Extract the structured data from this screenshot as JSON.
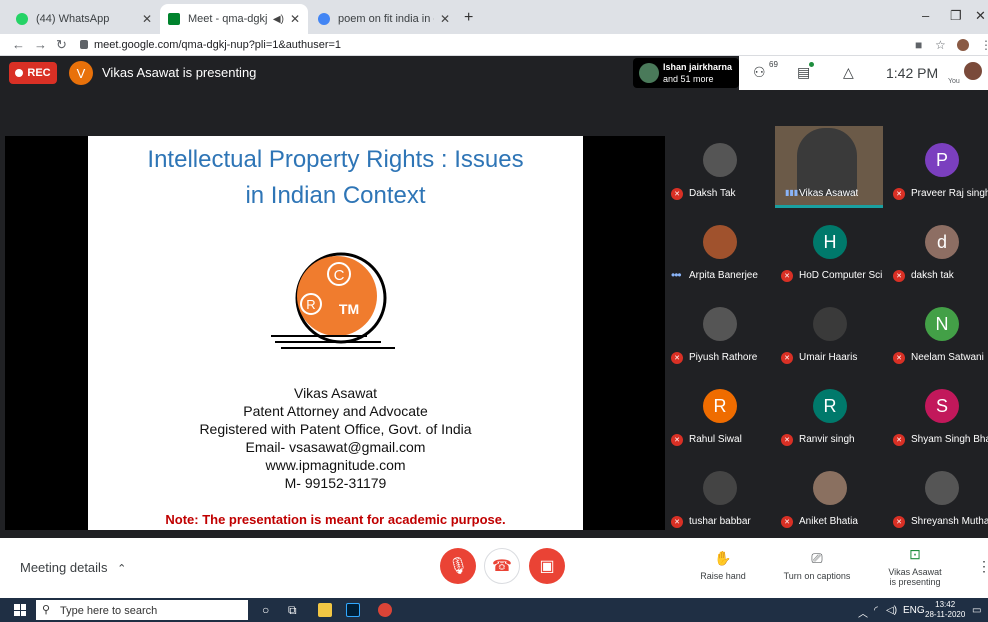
{
  "browser": {
    "tabs": [
      {
        "title": "(44) WhatsApp",
        "favicon_color": "#25d366"
      },
      {
        "title": "Meet - qma-dgkj-nup",
        "favicon_color": "#00832d"
      },
      {
        "title": "poem on fit india in english - Go",
        "favicon_color": "#4285f4"
      }
    ],
    "url": "meet.google.com/qma-dgkj-nup?pli=1&authuser=1"
  },
  "meet": {
    "rec_label": "REC",
    "presenter_initial": "V",
    "presenting_text": "Vikas Asawat is presenting",
    "join_notification": {
      "line1": "Ishan jairkharna",
      "line2": "and 51 more"
    },
    "participant_count_badge": "69",
    "clock": "1:42 PM",
    "self_label": "You"
  },
  "slide": {
    "title_line1": "Intellectual Property Rights : Issues",
    "title_line2": "in Indian Context",
    "logo_letters": {
      "c": "C",
      "r": "R",
      "tm": "TM"
    },
    "author": "Vikas Asawat",
    "role": "Patent Attorney and Advocate",
    "registration": "Registered with Patent Office, Govt. of India",
    "email": "Email- vsasawat@gmail.com",
    "website": "www.ipmagnitude.com",
    "mobile": "M- 99152-31179",
    "note": "Note: The presentation is meant for academic purpose."
  },
  "participants": [
    {
      "name": "Daksh Tak",
      "initial": "",
      "color": "#555555",
      "status": "muted"
    },
    {
      "name": "Vikas Asawat",
      "initial": "",
      "color": "#6b5a48",
      "status": "speaking"
    },
    {
      "name": "Praveer Raj singh",
      "initial": "P",
      "color": "#7b3fbf",
      "status": "muted"
    },
    {
      "name": "Arpita Banerjee",
      "initial": "",
      "color": "#a0522d",
      "status": "dots"
    },
    {
      "name": "HoD Computer Sci...",
      "initial": "H",
      "color": "#00796b",
      "status": "muted"
    },
    {
      "name": "daksh tak",
      "initial": "d",
      "color": "#8d6e63",
      "status": "muted"
    },
    {
      "name": "Piyush Rathore",
      "initial": "",
      "color": "#555555",
      "status": "muted"
    },
    {
      "name": "Umair Haaris",
      "initial": "",
      "color": "#3a3a3a",
      "status": "muted"
    },
    {
      "name": "Neelam Satwani",
      "initial": "N",
      "color": "#43a047",
      "status": "muted"
    },
    {
      "name": "Rahul Siwal",
      "initial": "R",
      "color": "#ef6c00",
      "status": "muted"
    },
    {
      "name": "Ranvir singh",
      "initial": "R",
      "color": "#00796b",
      "status": "muted"
    },
    {
      "name": "Shyam Singh Bhati",
      "initial": "S",
      "color": "#c2185b",
      "status": "muted"
    },
    {
      "name": "tushar babbar",
      "initial": "",
      "color": "#444444",
      "status": "muted"
    },
    {
      "name": "Aniket Bhatia",
      "initial": "",
      "color": "#8a7060",
      "status": "muted"
    },
    {
      "name": "Shreyansh Mutha",
      "initial": "",
      "color": "#555555",
      "status": "muted"
    }
  ],
  "bottom": {
    "meeting_details": "Meeting details",
    "raise_hand": "Raise hand",
    "captions": "Turn on captions",
    "presenting_line1": "Vikas Asawat",
    "presenting_line2": "is presenting"
  },
  "taskbar": {
    "search_placeholder": "Type here to search",
    "lang": "ENG",
    "time": "13:42",
    "date": "28-11-2020"
  }
}
